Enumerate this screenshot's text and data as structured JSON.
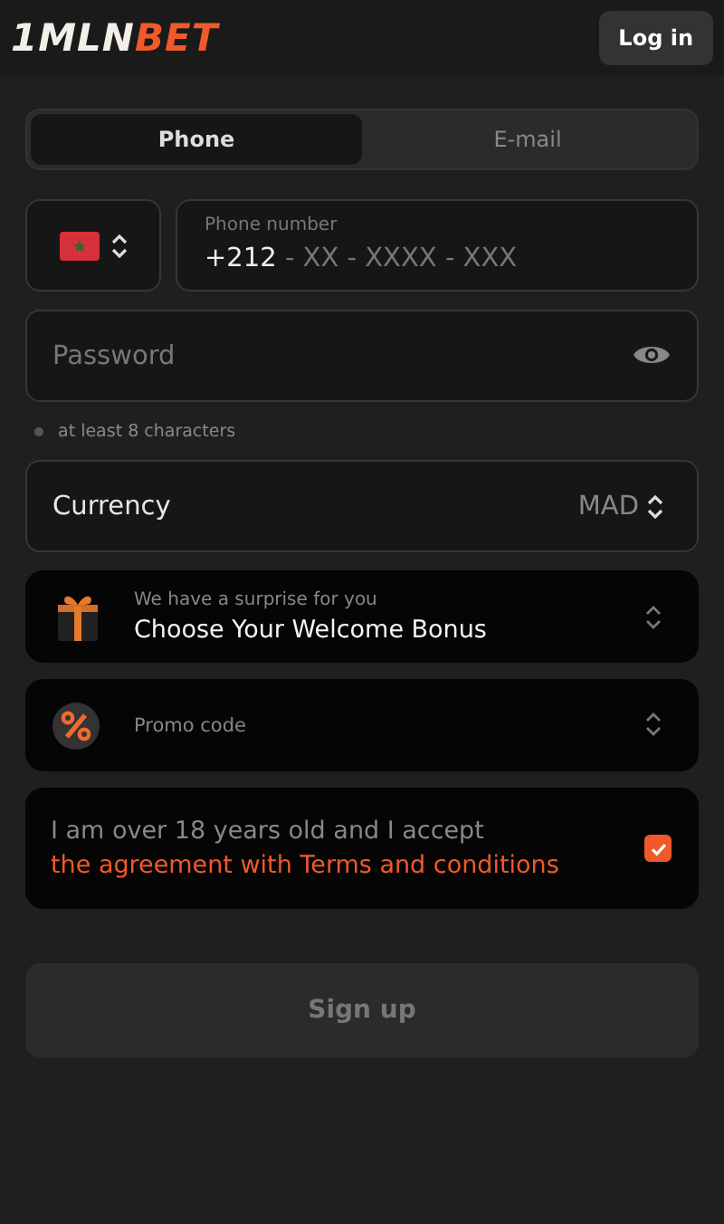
{
  "header": {
    "logo": {
      "part_1": "1MLN",
      "part_2": "BET"
    },
    "login_button": "Log in"
  },
  "tabs": [
    {
      "label": "Phone",
      "selected": true
    },
    {
      "label": "E-mail",
      "selected": false
    }
  ],
  "phone": {
    "label": "Phone number",
    "code": "+212",
    "mask": "- XX - XXXX - XXX"
  },
  "password": {
    "placeholder": "Password"
  },
  "password_hint": "at least 8 characters",
  "currency": {
    "label": "Currency",
    "value": "MAD"
  },
  "bonus": {
    "caption": "We have a surprise for you",
    "title": "Choose Your Welcome Bonus"
  },
  "promo": {
    "placeholder": "Promo code"
  },
  "terms": {
    "text": "I am over 18 years old and I accept",
    "link": "the agreement with Terms and conditions",
    "checked": true
  },
  "signup": {
    "label": "Sign up",
    "disabled": true
  }
}
